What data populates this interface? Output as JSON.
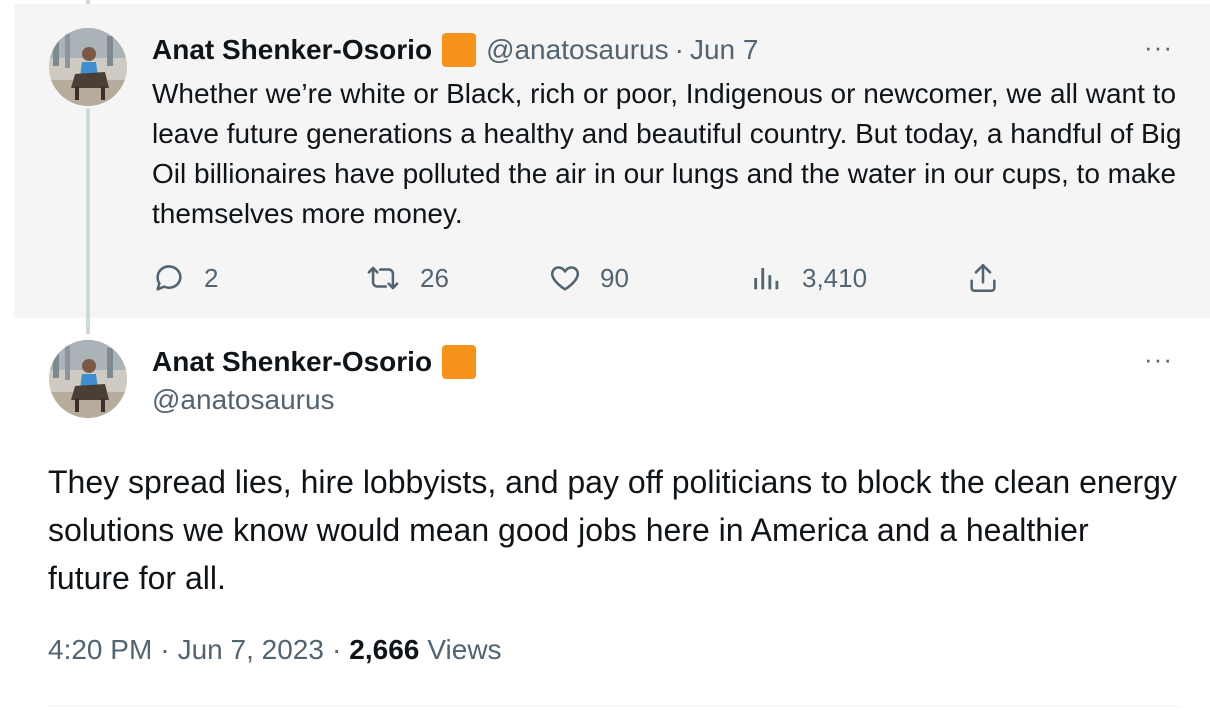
{
  "parent_tweet": {
    "author_name": "Anat Shenker-Osorio",
    "handle": "@anatosaurus",
    "separator": "·",
    "date": "Jun 7",
    "more_label": "···",
    "text": "Whether we’re white or Black, rich or poor, Indigenous or newcomer, we all want to leave future generations a healthy and beautiful country. But today, a handful of Big Oil billionaires have polluted the air in our lungs and the water in our cups, to make themselves more money.",
    "replies": "2",
    "retweets": "26",
    "likes": "90",
    "views": "3,410"
  },
  "main_tweet": {
    "author_name": "Anat Shenker-Osorio",
    "handle": "@anatosaurus",
    "more_label": "···",
    "text": "They spread lies, hire lobbyists, and pay off politicians to block the clean energy solutions we know would mean good jobs here in America and a healthier future for all.",
    "time": "4:20 PM",
    "separator": "·",
    "date": "Jun 7, 2023",
    "views_count": "2,666",
    "views_label": "Views"
  },
  "colors": {
    "badge": "#f7931a",
    "secondary_text": "#536471",
    "primary_text": "#0f1419",
    "parent_background": "#f5f5f5",
    "thread_line": "#cfd9de"
  },
  "icons": [
    "reply-icon",
    "retweet-icon",
    "like-icon",
    "views-icon",
    "share-icon",
    "more-icon",
    "verified-badge-icon"
  ]
}
